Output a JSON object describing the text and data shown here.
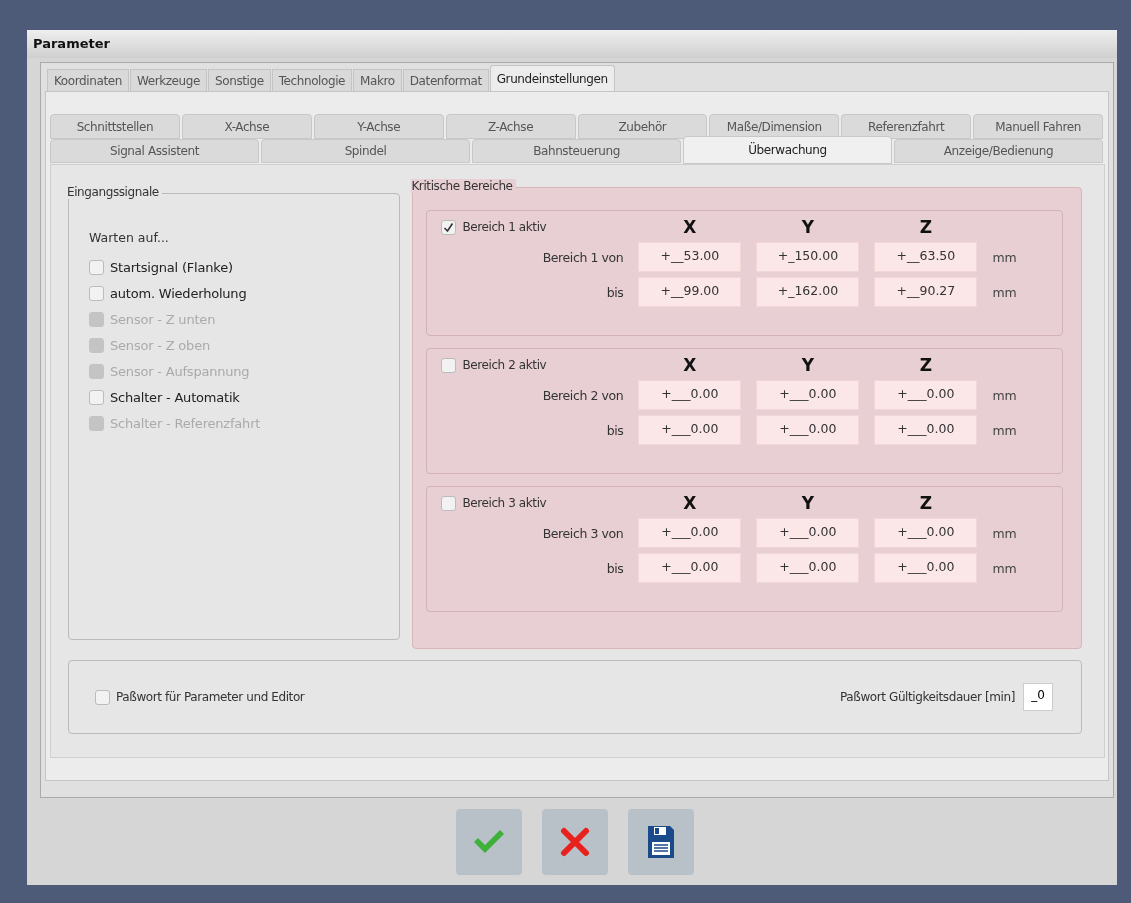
{
  "window": {
    "title": "Parameter"
  },
  "tabs": [
    {
      "label": "Koordinaten",
      "selected": false
    },
    {
      "label": "Werkzeuge",
      "selected": false
    },
    {
      "label": "Sonstige",
      "selected": false
    },
    {
      "label": "Technologie",
      "selected": false
    },
    {
      "label": "Makro",
      "selected": false
    },
    {
      "label": "Datenformat",
      "selected": false
    },
    {
      "label": "Grundeinstellungen",
      "selected": true
    }
  ],
  "subtabs_back": [
    {
      "label": "Schnittstellen",
      "selected": false
    },
    {
      "label": "X-Achse",
      "selected": false
    },
    {
      "label": "Y-Achse",
      "selected": false
    },
    {
      "label": "Z-Achse",
      "selected": false
    },
    {
      "label": "Zubehör",
      "selected": false
    },
    {
      "label": "Maße/Dimension",
      "selected": false
    },
    {
      "label": "Referenzfahrt",
      "selected": false
    },
    {
      "label": "Manuell Fahren",
      "selected": false
    }
  ],
  "subtabs_front": [
    {
      "label": "Signal Assistent",
      "selected": false
    },
    {
      "label": "Spindel",
      "selected": false
    },
    {
      "label": "Bahnsteuerung",
      "selected": false
    },
    {
      "label": "Überwachung",
      "selected": true
    },
    {
      "label": "Anzeige/Bedienung",
      "selected": false
    }
  ],
  "input_signals": {
    "title": "Eingangssignale",
    "caption": "Warten auf...",
    "items": [
      {
        "label": "Startsignal (Flanke)",
        "checked": false,
        "disabled": false
      },
      {
        "label": "autom. Wiederholung",
        "checked": false,
        "disabled": false
      },
      {
        "label": "Sensor - Z unten",
        "checked": false,
        "disabled": true
      },
      {
        "label": "Sensor - Z oben",
        "checked": false,
        "disabled": true
      },
      {
        "label": "Sensor - Aufspannung",
        "checked": false,
        "disabled": true
      },
      {
        "label": "Schalter - Automatik",
        "checked": false,
        "disabled": false
      },
      {
        "label": "Schalter - Referenzfahrt",
        "checked": false,
        "disabled": true
      }
    ]
  },
  "critical_areas": {
    "title": "Kritische Bereiche",
    "areas": [
      {
        "label": "Bereich 1 aktiv",
        "checked": true,
        "headers": [
          "X",
          "Y",
          "Z"
        ],
        "from_label": "Bereich 1 von",
        "from": [
          "+__53.00",
          "+_150.00",
          "+__63.50"
        ],
        "from_unit": "mm",
        "to_label": "bis",
        "to": [
          "+__99.00",
          "+_162.00",
          "+__90.27"
        ],
        "to_unit": "mm"
      },
      {
        "label": "Bereich 2 aktiv",
        "checked": false,
        "headers": [
          "X",
          "Y",
          "Z"
        ],
        "from_label": "Bereich 2 von",
        "from": [
          "+___0.00",
          "+___0.00",
          "+___0.00"
        ],
        "from_unit": "mm",
        "to_label": "bis",
        "to": [
          "+___0.00",
          "+___0.00",
          "+___0.00"
        ],
        "to_unit": "mm"
      },
      {
        "label": "Bereich 3 aktiv",
        "checked": false,
        "headers": [
          "X",
          "Y",
          "Z"
        ],
        "from_label": "Bereich 3 von",
        "from": [
          "+___0.00",
          "+___0.00",
          "+___0.00"
        ],
        "from_unit": "mm",
        "to_label": "bis",
        "to": [
          "+___0.00",
          "+___0.00",
          "+___0.00"
        ],
        "to_unit": "mm"
      }
    ]
  },
  "password": {
    "label": "Paßwort für Parameter und Editor",
    "checked": false,
    "validity_label": "Paßwort Gültigkeitsdauer [min]",
    "validity_value": "_0"
  },
  "buttons": [
    {
      "kind": "ok"
    },
    {
      "kind": "cancel"
    },
    {
      "kind": "save"
    }
  ]
}
